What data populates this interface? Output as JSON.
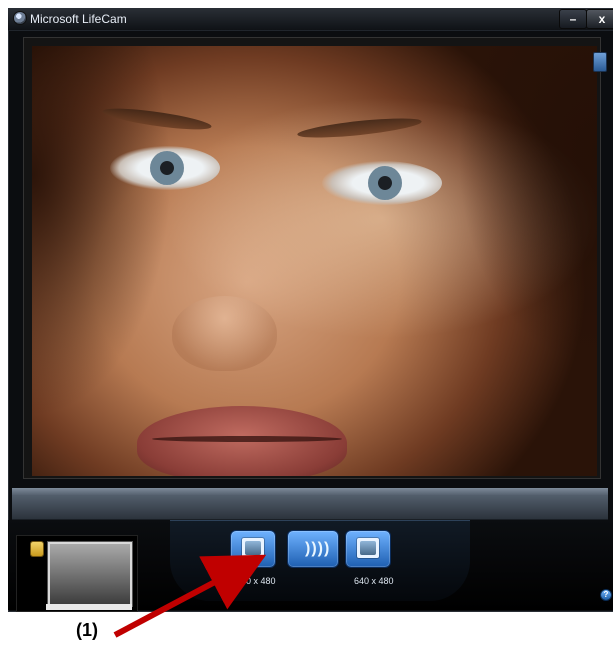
{
  "window": {
    "title": "Microsoft LifeCam",
    "minimize_label": "–",
    "close_label": "x"
  },
  "controls": {
    "photo_resolution": "640 x 480",
    "video_resolution": "640 x 480",
    "help_label": "?"
  },
  "annotation": {
    "label": "(1)"
  },
  "icons": {
    "app": "webcam-icon",
    "folder": "folder-icon",
    "photo_mode": "photo-mode-icon",
    "audio_mode": "audio-icon",
    "video_mode": "video-mode-icon",
    "help": "help-icon",
    "side": "side-panel-icon"
  },
  "colors": {
    "accent_blue": "#2a6cc8",
    "arrow_red": "#c00000"
  }
}
